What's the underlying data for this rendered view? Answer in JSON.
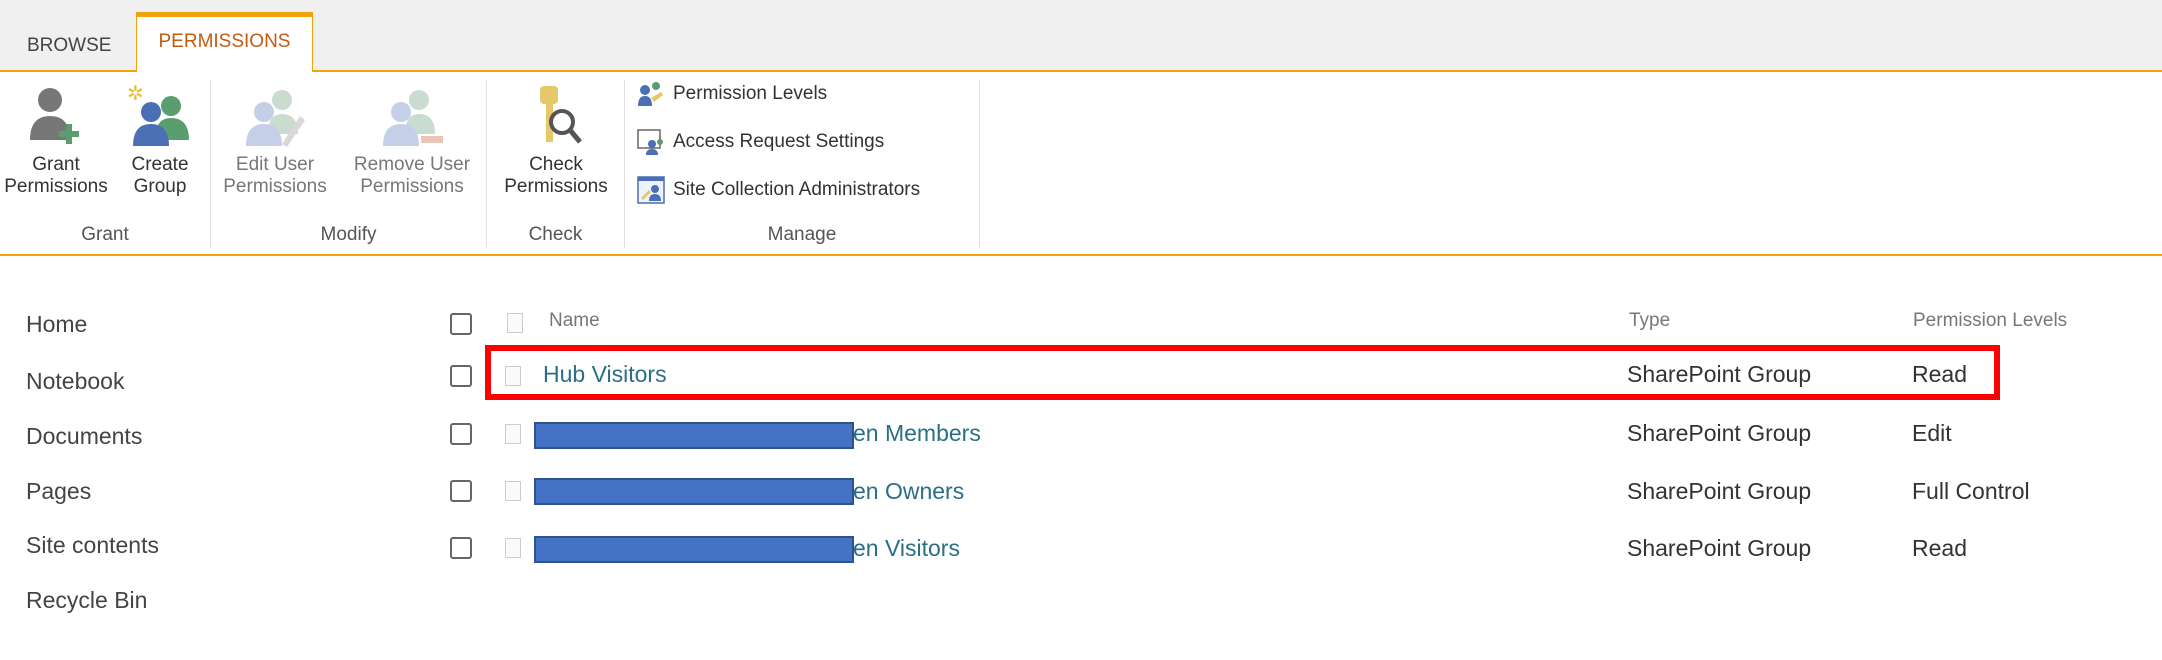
{
  "tabs": [
    {
      "label": "BROWSE"
    },
    {
      "label": "PERMISSIONS",
      "active": true
    }
  ],
  "ribbon": {
    "groups": [
      {
        "label": "Grant",
        "buttons": [
          {
            "line1": "Grant",
            "line2": "Permissions",
            "icon": "grant-permissions-icon"
          },
          {
            "line1": "Create",
            "line2": "Group",
            "icon": "create-group-icon"
          }
        ]
      },
      {
        "label": "Modify",
        "buttons": [
          {
            "line1": "Edit User",
            "line2": "Permissions",
            "icon": "edit-user-permissions-icon",
            "disabled": true
          },
          {
            "line1": "Remove User",
            "line2": "Permissions",
            "icon": "remove-user-permissions-icon",
            "disabled": true
          }
        ]
      },
      {
        "label": "Check",
        "buttons": [
          {
            "line1": "Check",
            "line2": "Permissions",
            "icon": "check-permissions-icon"
          }
        ]
      },
      {
        "label": "Manage",
        "items": [
          {
            "label": "Permission Levels",
            "icon": "permission-levels-icon"
          },
          {
            "label": "Access Request Settings",
            "icon": "access-request-icon"
          },
          {
            "label": "Site Collection Administrators",
            "icon": "site-admins-icon"
          }
        ]
      }
    ]
  },
  "nav": [
    "Home",
    "Notebook",
    "Documents",
    "Pages",
    "Site contents",
    "Recycle Bin"
  ],
  "table": {
    "headers": {
      "name": "Name",
      "type": "Type",
      "permission": "Permission Levels"
    },
    "rows": [
      {
        "name": "Hub Visitors",
        "type": "SharePoint Group",
        "permission": "Read",
        "highlighted": true
      },
      {
        "name": "en Members",
        "type": "SharePoint Group",
        "permission": "Edit",
        "redacted": true
      },
      {
        "name": "en Owners",
        "type": "SharePoint Group",
        "permission": "Full Control",
        "redacted": true
      },
      {
        "name": "en Visitors",
        "type": "SharePoint Group",
        "permission": "Read",
        "redacted": true
      }
    ]
  },
  "colors": {
    "accent": "#f0a30a",
    "highlight": "#ff0000",
    "redaction": "#4472c4",
    "link": "#2a6f86"
  }
}
